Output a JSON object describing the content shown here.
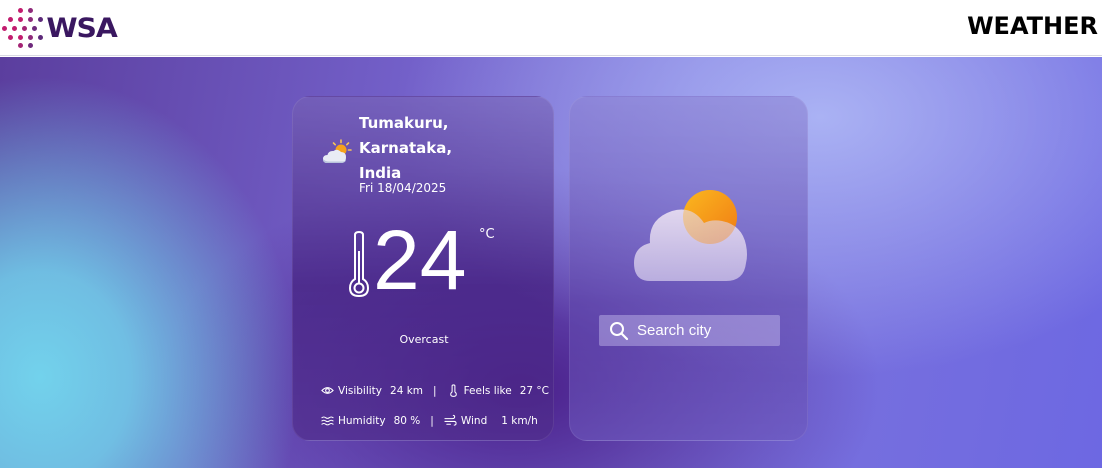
{
  "header": {
    "logo_text": "WSA",
    "title": "WEATHER"
  },
  "current": {
    "location_line1": "Tumakuru,",
    "location_line2": "Karnataka,",
    "location_line3": "India",
    "date": "Fri 18/04/2025",
    "temperature": "24",
    "unit": "°C",
    "condition": "Overcast",
    "condition_icon": "partly-cloudy-icon",
    "visibility_label": "Visibility",
    "visibility_value": "24 km",
    "feels_label": "Feels like",
    "feels_value": "27 °C",
    "humidity_label": "Humidity",
    "humidity_value": "80 %",
    "wind_label": "Wind",
    "wind_value": "1 km/h",
    "separator": "|"
  },
  "search": {
    "placeholder": "Search city",
    "value": ""
  },
  "colors": {
    "brand": "#c21c6e",
    "brand_text": "#3a1760",
    "accent_sun": "#f7a21b"
  }
}
